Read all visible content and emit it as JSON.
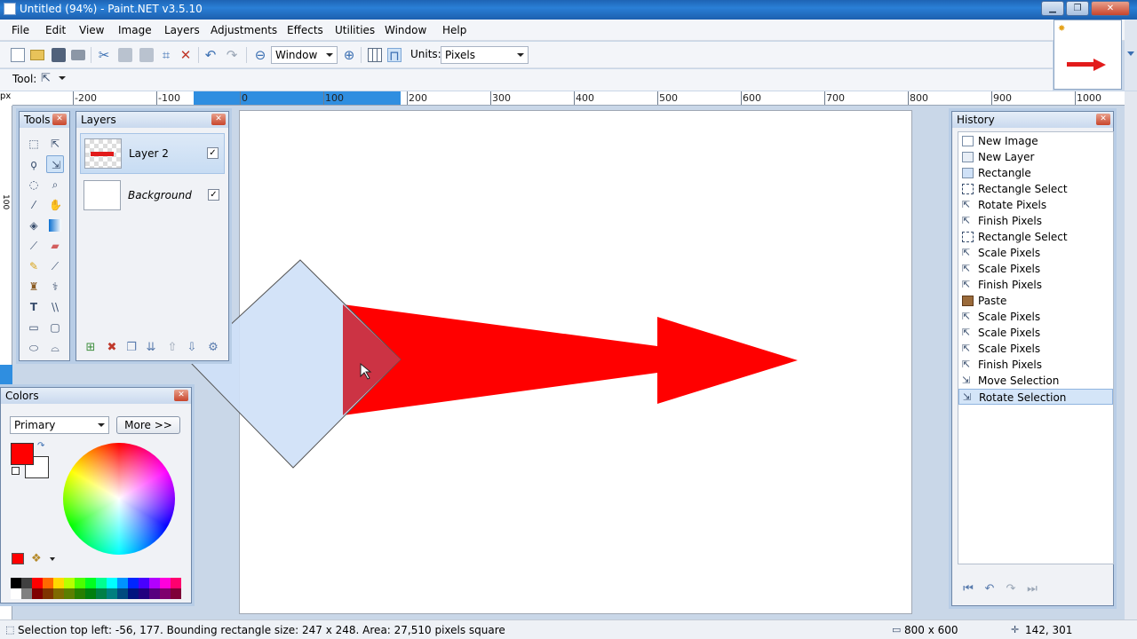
{
  "window": {
    "title": "Untitled (94%) - Paint.NET v3.5.10"
  },
  "menu": [
    "File",
    "Edit",
    "View",
    "Image",
    "Layers",
    "Adjustments",
    "Effects",
    "Utilities",
    "Window",
    "Help"
  ],
  "toolbar": {
    "zoom_value": "Window",
    "units_label": "Units:",
    "units_value": "Pixels"
  },
  "toolrow": {
    "label": "Tool:"
  },
  "ruler": {
    "unit": "px",
    "top_labels": [
      "-200",
      "-100",
      "0",
      "100",
      "200",
      "300",
      "400",
      "500",
      "600",
      "700",
      "800",
      "900",
      "1000"
    ],
    "left_labels": [
      "100",
      "200"
    ]
  },
  "tools_panel": {
    "title": "Tools"
  },
  "layers_panel": {
    "title": "Layers",
    "layers": [
      {
        "name": "Layer 2",
        "visible": true,
        "selected": true
      },
      {
        "name": "Background",
        "visible": true,
        "selected": false
      }
    ]
  },
  "colors_panel": {
    "title": "Colors",
    "selector_value": "Primary",
    "more_label": "More >>",
    "primary_color": "#ff0000",
    "secondary_color": "#ffffff"
  },
  "history_panel": {
    "title": "History",
    "items": [
      "New Image",
      "New Layer",
      "Rectangle",
      "Rectangle Select",
      "Rotate Pixels",
      "Finish Pixels",
      "Rectangle Select",
      "Scale Pixels",
      "Scale Pixels",
      "Finish Pixels",
      "Paste",
      "Scale Pixels",
      "Scale Pixels",
      "Scale Pixels",
      "Finish Pixels",
      "Move Selection",
      "Rotate Selection"
    ],
    "selected_index": 16
  },
  "status": {
    "text": "Selection top left: -56, 177. Bounding rectangle size: 247 x 248. Area: 27,510 pixels square",
    "image_size": "800 x 600",
    "cursor": "142, 301"
  },
  "colors": {
    "accent": "#2f8ee0",
    "arrow_red": "#ff0000"
  }
}
